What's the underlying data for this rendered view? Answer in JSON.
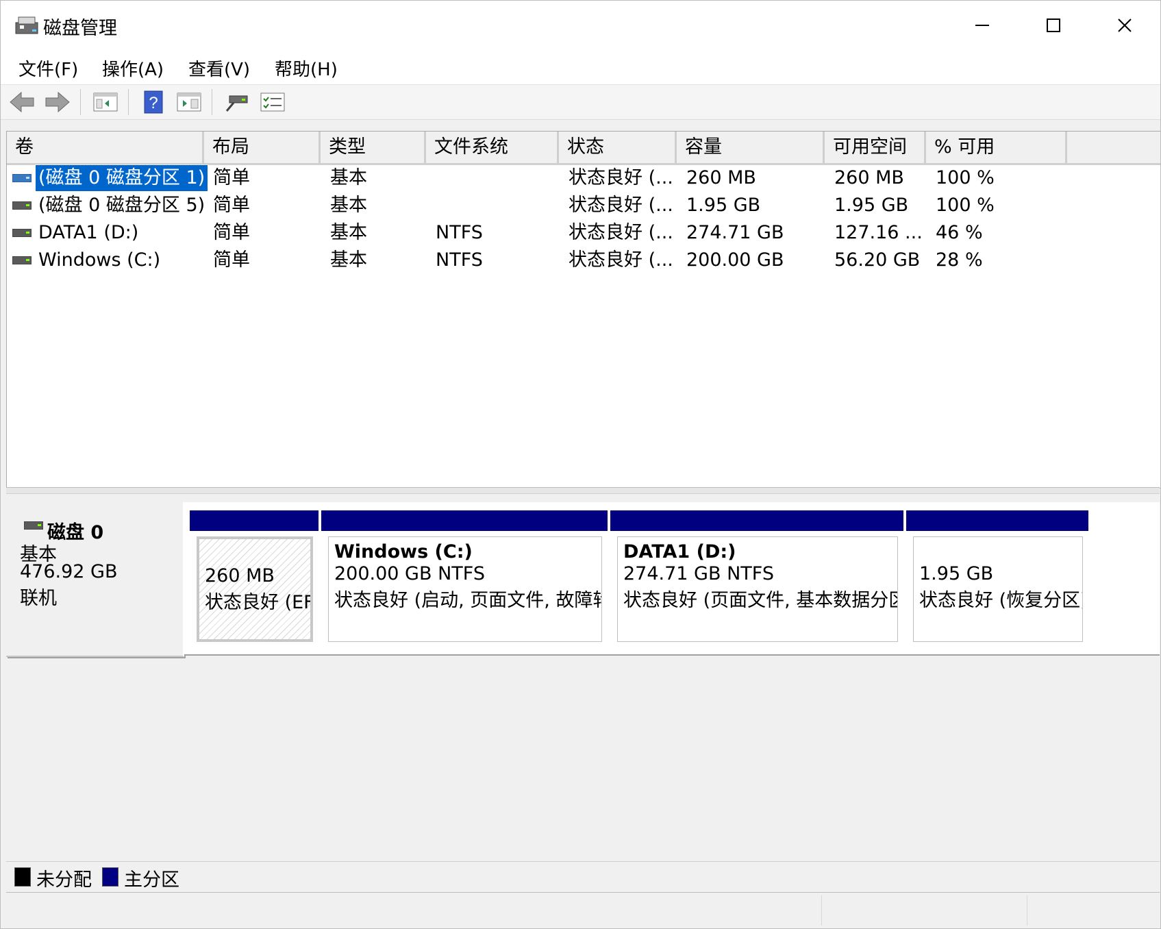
{
  "window": {
    "title": "磁盘管理"
  },
  "menu": [
    "文件(F)",
    "操作(A)",
    "查看(V)",
    "帮助(H)"
  ],
  "columns": [
    "卷",
    "布局",
    "类型",
    "文件系统",
    "状态",
    "容量",
    "可用空间",
    "% 可用"
  ],
  "volumes": [
    {
      "name": "(磁盘 0 磁盘分区 1)",
      "layout": "简单",
      "type": "基本",
      "fs": "",
      "status": "状态良好 (...",
      "capacity": "260 MB",
      "free": "260 MB",
      "pct": "100 %"
    },
    {
      "name": "(磁盘 0 磁盘分区 5)",
      "layout": "简单",
      "type": "基本",
      "fs": "",
      "status": "状态良好 (...",
      "capacity": "1.95 GB",
      "free": "1.95 GB",
      "pct": "100 %"
    },
    {
      "name": "DATA1 (D:)",
      "layout": "简单",
      "type": "基本",
      "fs": "NTFS",
      "status": "状态良好 (...",
      "capacity": "274.71 GB",
      "free": "127.16 ...",
      "pct": "46 %"
    },
    {
      "name": "Windows (C:)",
      "layout": "简单",
      "type": "基本",
      "fs": "NTFS",
      "status": "状态良好 (...",
      "capacity": "200.00 GB",
      "free": "56.20 GB",
      "pct": "28 %"
    }
  ],
  "disk": {
    "name": "磁盘 0",
    "kind": "基本",
    "size": "476.92 GB",
    "state": "联机"
  },
  "partitions": [
    {
      "name": "",
      "size": "260 MB",
      "status": "状态良好 (EFI 系统分区)"
    },
    {
      "name": "Windows  (C:)",
      "size": "200.00 GB NTFS",
      "status": "状态良好 (启动, 页面文件, 故障转储, 基本数据分区)"
    },
    {
      "name": "DATA1  (D:)",
      "size": "274.71 GB NTFS",
      "status": "状态良好 (页面文件, 基本数据分区)"
    },
    {
      "name": "",
      "size": "1.95 GB",
      "status": "状态良好 (恢复分区)"
    }
  ],
  "legend": [
    {
      "label": "未分配",
      "color": "#000000"
    },
    {
      "label": "主分区",
      "color": "#000080"
    }
  ],
  "toolbar_icons": [
    "back-arrow-icon",
    "forward-arrow-icon",
    "console-tree-icon",
    "help-icon",
    "action-pane-icon",
    "connect-disk-icon",
    "properties-icon"
  ],
  "colors": {
    "selection": "#0066cc",
    "primary_partition": "#000080"
  }
}
